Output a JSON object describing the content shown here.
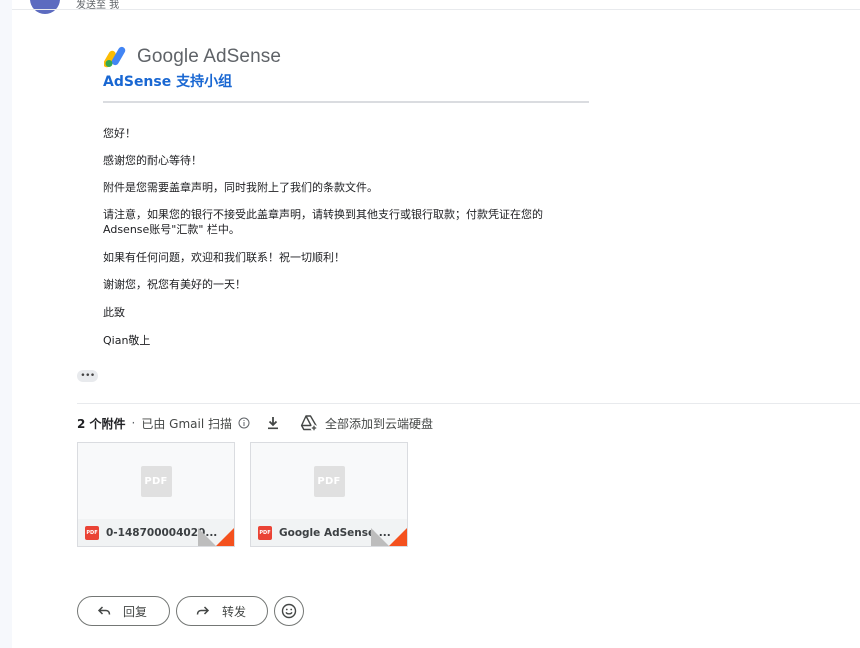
{
  "header": {
    "to_snippet": "发送至 我",
    "logo_text": "Google AdSense",
    "support_title": "AdSense 支持小组"
  },
  "body": {
    "paragraphs": [
      "您好！",
      "感谢您的耐心等待！",
      "附件是您需要盖章声明，同时我附上了我们的条款文件。",
      "请注意，如果您的银行不接受此盖章声明，请转换到其他支行或银行取款；付款凭证在您的Adsense账号\"汇款\" 栏中。",
      "如果有任何问题，欢迎和我们联系！祝一切顺利！",
      "谢谢您，祝您有美好的一天！",
      "此致",
      "Qian敬上"
    ],
    "ellipsis": "•••"
  },
  "attachments": {
    "count_label": "2 个附件",
    "separator": "·",
    "scan_label": "已由 Gmail 扫描",
    "add_all_label": "全部添加到云端硬盘",
    "files": [
      {
        "thumb_label": "PDF",
        "icon_label": "PDF",
        "name": "0-148700004020..."
      },
      {
        "thumb_label": "PDF",
        "icon_label": "PDF",
        "name": "Google AdSense ..."
      }
    ]
  },
  "actions": {
    "reply_label": "回复",
    "forward_label": "转发"
  },
  "colors": {
    "brand_blue": "#1967d2",
    "pdf_red": "#ea4335",
    "corner_orange": "#f4511e"
  }
}
